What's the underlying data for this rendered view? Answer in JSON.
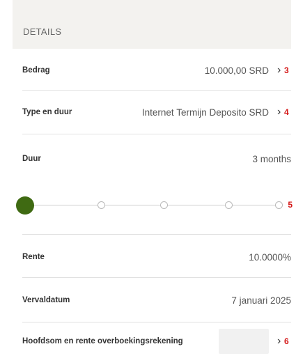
{
  "details": {
    "header": "DETAILS",
    "bedrag": {
      "label": "Bedrag",
      "value": "10.000,00 SRD",
      "marker": "3"
    },
    "type": {
      "label": "Type en duur",
      "value": "Internet Termijn Deposito SRD",
      "marker": "4"
    },
    "duur": {
      "label": "Duur",
      "value": "3 months"
    },
    "slider": {
      "selected_index": 0,
      "stop_count": 5,
      "marker": "5"
    },
    "rente": {
      "label": "Rente",
      "value": "10.0000%"
    },
    "vervaldatum": {
      "label": "Vervaldatum",
      "value": "7 januari 2025"
    },
    "rekening": {
      "label": "Hoofdsom en rente overboekingsrekening",
      "value": "",
      "marker": "6"
    }
  },
  "icons": {
    "chevron": "chevron-right-icon"
  },
  "colors": {
    "accent": "#3f6a12",
    "header_bg": "#f3f2ef",
    "marker": "#d41818"
  }
}
